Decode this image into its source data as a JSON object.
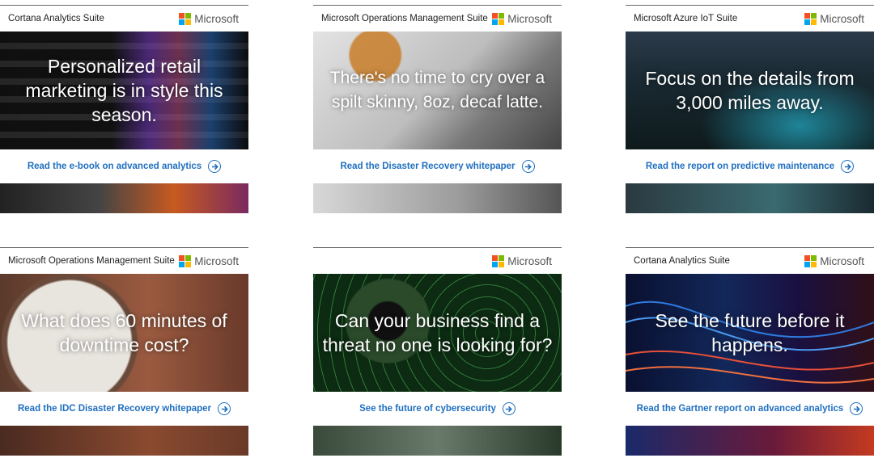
{
  "brand": "Microsoft",
  "ads": [
    {
      "suite": "Cortana Analytics Suite",
      "headline": "Personalized retail marketing is in style this season.",
      "cta": "Read the e-book on advanced analytics"
    },
    {
      "suite": "Microsoft Operations Management Suite",
      "headline": "There's no time to cry over a spilt skinny, 8oz, decaf latte.",
      "cta": "Read the Disaster Recovery whitepaper"
    },
    {
      "suite": "Microsoft Azure IoT Suite",
      "headline": "Focus on the details from 3,000 miles away.",
      "cta": "Read the report on predictive maintenance"
    },
    {
      "suite": "Microsoft Operations Management Suite",
      "headline": "What does 60 minutes of downtime cost?",
      "cta": "Read the IDC Disaster Recovery whitepaper"
    },
    {
      "suite": "",
      "headline": "Can your business find a threat no one is looking for?",
      "cta": "See the future of cybersecurity"
    },
    {
      "suite": "Cortana Analytics Suite",
      "headline": "See the future before it happens.",
      "cta": "Read the Gartner report on advanced analytics"
    }
  ],
  "colors": {
    "link": "#1f6fbf",
    "ms_red": "#f25022",
    "ms_green": "#7fba00",
    "ms_blue": "#00a4ef",
    "ms_yellow": "#ffb900"
  },
  "icons": {
    "cta": "arrow-right-circle-icon",
    "logo": "microsoft-logo-icon"
  }
}
